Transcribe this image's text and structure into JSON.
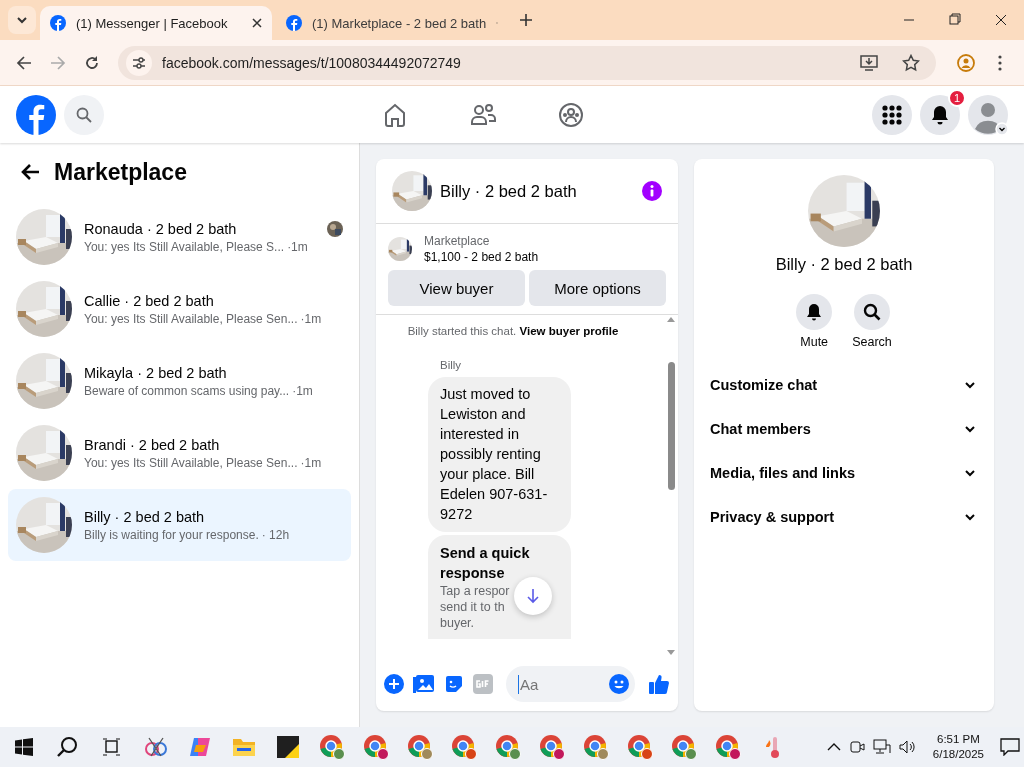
{
  "browser": {
    "tabs": [
      {
        "title": "(1) Messenger | Facebook",
        "selected": true
      },
      {
        "title": "(1) Marketplace - 2 bed 2 bath",
        "selected": false
      }
    ],
    "url": "facebook.com/messages/t/10080344492072749"
  },
  "header": {
    "notification_count": "1"
  },
  "sidebar": {
    "title": "Marketplace",
    "conversations": [
      {
        "name": "Ronauda · 2 bed 2 bath",
        "preview": "You: yes Its Still Available, Please S...",
        "time": "·1m",
        "seen": true,
        "selected": false
      },
      {
        "name": "Callie · 2 bed 2 bath",
        "preview": "You: yes Its Still Available, Please Sen...",
        "time": "·1m",
        "seen": false,
        "selected": false
      },
      {
        "name": "Mikayla · 2 bed 2 bath",
        "preview": "Beware of common scams using pay...",
        "time": "·1m",
        "seen": false,
        "selected": false
      },
      {
        "name": "Brandi · 2 bed 2 bath",
        "preview": "You: yes Its Still Available, Please Sen...",
        "time": "·1m",
        "seen": false,
        "selected": false
      },
      {
        "name": "Billy · 2 bed 2 bath",
        "preview": "Billy is waiting for your response.",
        "time": "· 12h",
        "seen": false,
        "selected": true
      }
    ]
  },
  "chat": {
    "title": "Billy · 2 bed 2 bath",
    "listing_label": "Marketplace",
    "listing_title": "$1,100 - 2 bed 2 bath",
    "buttons": [
      "View buyer",
      "More options"
    ],
    "notice": "Billy started this chat.",
    "notice_link": "View buyer profile",
    "sender": "Billy",
    "message": "Just moved to Lewiston and interested in possibly renting your place. Bill Edelen 907-631-9272",
    "quick_response": {
      "title": "Send a quick response",
      "lines": [
        "Tap a respor",
        "send it to th",
        "buyer."
      ]
    },
    "composer": {
      "placeholder": "Aa"
    }
  },
  "details": {
    "title": "Billy · 2 bed 2 bath",
    "actions": [
      {
        "kind": "mute",
        "label": "Mute"
      },
      {
        "kind": "search",
        "label": "Search"
      }
    ],
    "sections": [
      {
        "label": "Customize chat",
        "expanded": false
      },
      {
        "label": "Chat members",
        "expanded": false
      },
      {
        "label": "Media, files and links",
        "expanded": false
      },
      {
        "label": "Privacy & support",
        "expanded": false
      }
    ]
  },
  "taskbar": {
    "time": "6:51 PM",
    "date": "6/18/2025"
  }
}
